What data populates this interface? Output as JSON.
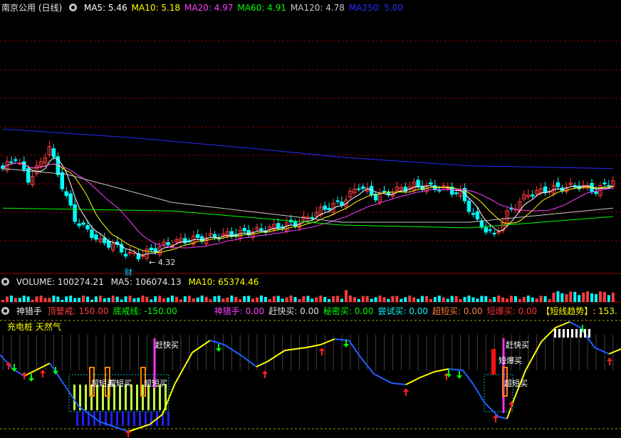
{
  "header": {
    "stock_title": "南京公用 (日线)",
    "mas": [
      {
        "label": "MA5: 5.46",
        "color": "#ffffff"
      },
      {
        "label": "MA10: 5.18",
        "color": "#ffff00"
      },
      {
        "label": "MA20: 4.97",
        "color": "#ff40ff"
      },
      {
        "label": "MA60: 4.91",
        "color": "#00ff00"
      },
      {
        "label": "MA120: 4.78",
        "color": "#c8c8c8"
      },
      {
        "label": "MA250: 5.00",
        "color": "#2a2aff"
      }
    ]
  },
  "main_chart": {
    "low_label": "4.32",
    "finance_badge": "财"
  },
  "volume_header": {
    "volume": "VOLUME: 100274.21",
    "ma5": "MA5: 106074.13",
    "ma10": "MA10: 65374.46"
  },
  "indicator_header": {
    "name": "神猎手",
    "items": [
      {
        "label": "顶警戒: 150.00",
        "color": "#ff4040"
      },
      {
        "label": "底戒线: -150.00",
        "color": "#00ff00"
      },
      {
        "label": "神猎手: 0.00",
        "color": "#ff40ff"
      },
      {
        "label": "赶快买: 0.00",
        "color": "#e0e0e0"
      },
      {
        "label": "秘密买: 0.00",
        "color": "#00ff00"
      },
      {
        "label": "尝试买: 0.00",
        "color": "#00ffff"
      },
      {
        "label": "超短买: 0.00",
        "color": "#ff8040"
      },
      {
        "label": "短爆买: 0.00",
        "color": "#ff3030"
      },
      {
        "label": "【短线趋势】: 153.",
        "color": "#ffff00"
      }
    ],
    "sub_title": "充电桩 天然气"
  },
  "indicator_labels": {
    "quick_buy_1": "赶快买",
    "super_short_1": "超短买",
    "super_short_2": "超短买",
    "super_short_3": "超短买",
    "quick_buy_2": "赶快买",
    "short_burst": "短爆买",
    "super_short_4": "超短买"
  },
  "colors": {
    "up": "#ff3c3c",
    "down": "#00ffff",
    "grid": "#8b0000",
    "ma5": "#ffffff",
    "ma10": "#ffff00",
    "ma20": "#ff40ff",
    "ma60": "#00ff00",
    "ma120": "#c8c8c8",
    "ma250": "#2a2aff"
  },
  "chart_data": {
    "type": "candlestick",
    "title": "南京公用 (日线)",
    "series": [
      {
        "name": "MA5",
        "last": 5.46
      },
      {
        "name": "MA10",
        "last": 5.18
      },
      {
        "name": "MA20",
        "last": 4.97
      },
      {
        "name": "MA60",
        "last": 4.91
      },
      {
        "name": "MA120",
        "last": 4.78
      },
      {
        "name": "MA250",
        "last": 5.0
      }
    ],
    "annotations": [
      {
        "text": "4.32",
        "kind": "period-low"
      }
    ],
    "volume": {
      "VOLUME": 100274.21,
      "MA5": 106074.13,
      "MA10": 65374.46
    },
    "indicator": {
      "name": "神猎手",
      "values": {
        "顶警戒": 150.0,
        "底戒线": -150.0,
        "神猎手": 0.0,
        "赶快买": 0.0,
        "秘密买": 0.0,
        "尝试买": 0.0,
        "超短买": 0.0,
        "短爆买": 0.0
      }
    }
  }
}
